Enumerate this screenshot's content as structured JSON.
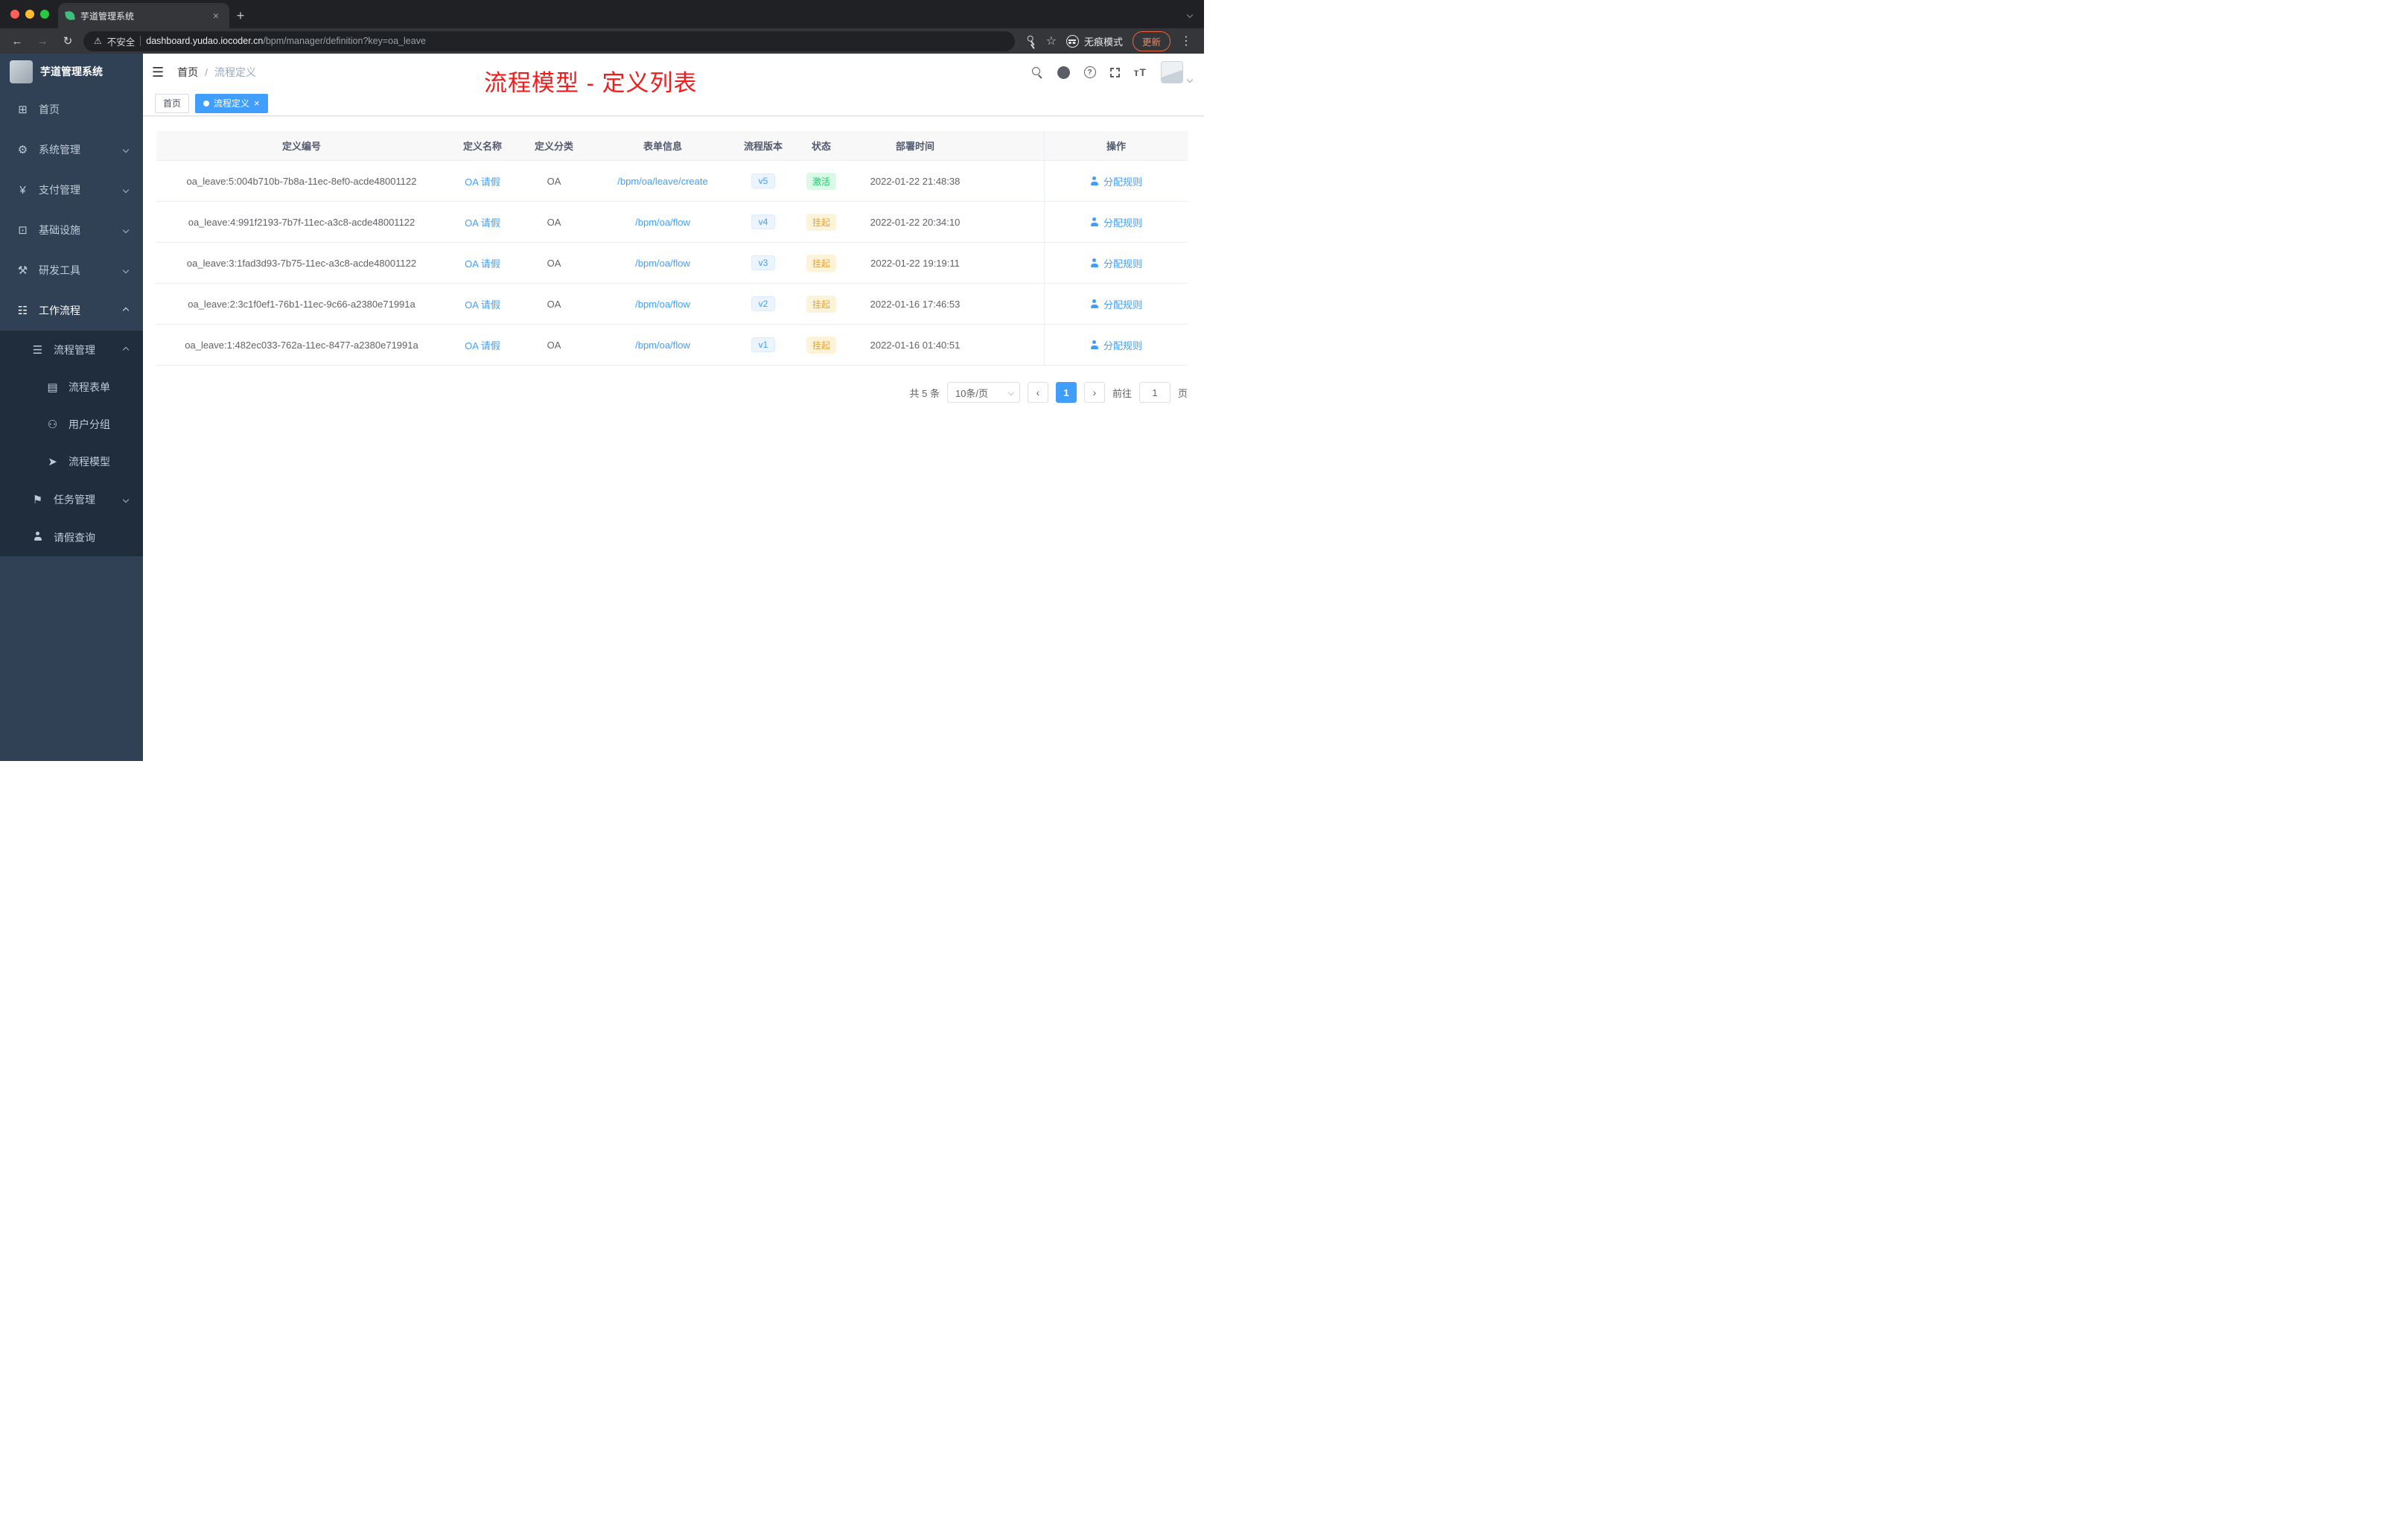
{
  "browser": {
    "tab_title": "芋道管理系统",
    "security_label": "不安全",
    "url_host": "dashboard.yudao.iocoder.cn",
    "url_path": "/bpm/manager/definition?key=oa_leave",
    "incognito_label": "无痕模式",
    "update_label": "更新"
  },
  "sidebar": {
    "app_title": "芋道管理系统",
    "items": [
      {
        "label": "首页"
      },
      {
        "label": "系统管理"
      },
      {
        "label": "支付管理"
      },
      {
        "label": "基础设施"
      },
      {
        "label": "研发工具"
      },
      {
        "label": "工作流程"
      }
    ],
    "submenu": [
      {
        "label": "流程管理"
      },
      {
        "label": "流程表单"
      },
      {
        "label": "用户分组"
      },
      {
        "label": "流程模型"
      },
      {
        "label": "任务管理"
      },
      {
        "label": "请假查询"
      }
    ]
  },
  "header": {
    "breadcrumb_home": "首页",
    "breadcrumb_separator": "/",
    "breadcrumb_current": "流程定义",
    "annotation": "流程模型 - 定义列表"
  },
  "tags": {
    "home": "首页",
    "active": "流程定义"
  },
  "table": {
    "columns": {
      "id": "定义编号",
      "name": "定义名称",
      "category": "定义分类",
      "form": "表单信息",
      "version": "流程版本",
      "status": "状态",
      "deploy_time": "部署时间",
      "action": "操作"
    },
    "rows": [
      {
        "id": "oa_leave:5:004b710b-7b8a-11ec-8ef0-acde48001122",
        "name": "OA 请假",
        "category": "OA",
        "form": "/bpm/oa/leave/create",
        "version": "v5",
        "status": "激活",
        "deploy_time": "2022-01-22 21:48:38",
        "action": "分配规则"
      },
      {
        "id": "oa_leave:4:991f2193-7b7f-11ec-a3c8-acde48001122",
        "name": "OA 请假",
        "category": "OA",
        "form": "/bpm/oa/flow",
        "version": "v4",
        "status": "挂起",
        "deploy_time": "2022-01-22 20:34:10",
        "action": "分配规则"
      },
      {
        "id": "oa_leave:3:1fad3d93-7b75-11ec-a3c8-acde48001122",
        "name": "OA 请假",
        "category": "OA",
        "form": "/bpm/oa/flow",
        "version": "v3",
        "status": "挂起",
        "deploy_time": "2022-01-22 19:19:11",
        "action": "分配规则"
      },
      {
        "id": "oa_leave:2:3c1f0ef1-76b1-11ec-9c66-a2380e71991a",
        "name": "OA 请假",
        "category": "OA",
        "form": "/bpm/oa/flow",
        "version": "v2",
        "status": "挂起",
        "deploy_time": "2022-01-16 17:46:53",
        "action": "分配规则"
      },
      {
        "id": "oa_leave:1:482ec033-762a-11ec-8477-a2380e71991a",
        "name": "OA 请假",
        "category": "OA",
        "form": "/bpm/oa/flow",
        "version": "v1",
        "status": "挂起",
        "deploy_time": "2022-01-16 01:40:51",
        "action": "分配规则"
      }
    ]
  },
  "pagination": {
    "total": "共 5 条",
    "page_size": "10条/页",
    "current_page": "1",
    "goto_label": "前往",
    "goto_value": "1",
    "page_unit": "页"
  },
  "icons": {
    "dashboard": "⊞",
    "gear": "⚙",
    "yen": "¥",
    "infra": "⊡",
    "tools": "⚒",
    "workflow": "☷",
    "process_list": "☰",
    "form": "▤",
    "users": "⚇",
    "model": "➤",
    "task": "⚑",
    "hamburger": "☰",
    "back": "←",
    "forward": "→",
    "reload": "↻",
    "star": "☆",
    "warning": "⚠",
    "close": "×",
    "plus": "+",
    "dots": "⋮",
    "prev": "‹",
    "next": "›",
    "question": "?",
    "fontsize": "тT"
  },
  "colors": {
    "accent_blue": "#409eff",
    "status_active_green": "#13ce66",
    "status_suspended_orange": "#e6a23c",
    "annotation_red": "#f21c1c",
    "sidebar_bg": "#304156",
    "submenu_bg": "#1f2d3d"
  }
}
